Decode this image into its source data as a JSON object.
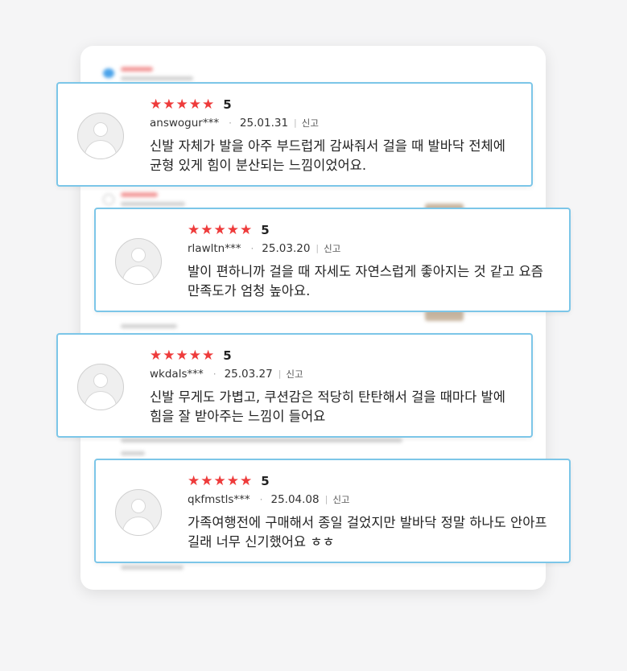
{
  "reviews": [
    {
      "rating_stars": "★★★★★",
      "score": "5",
      "username": "answogur***",
      "date": "25.01.31",
      "report_label": "신고",
      "text": "신발 자체가 발을 아주 부드럽게 감싸줘서 걸을 때 발바닥 전체에 균형 있게 힘이 분산되는 느낌이었어요."
    },
    {
      "rating_stars": "★★★★★",
      "score": "5",
      "username": "rlawltn***",
      "date": "25.03.20",
      "report_label": "신고",
      "text": "발이 편하니까 걸을 때 자세도 자연스럽게 좋아지는 것 같고 요즘 만족도가 엄청 높아요."
    },
    {
      "rating_stars": "★★★★★",
      "score": "5",
      "username": "wkdals***",
      "date": "25.03.27",
      "report_label": "신고",
      "text": "신발 무게도 가볍고, 쿠션감은 적당히 탄탄해서 걸을 때마다 발에 힘을 잘 받아주는 느낌이 들어요"
    },
    {
      "rating_stars": "★★★★★",
      "score": "5",
      "username": "qkfmstls***",
      "date": "25.04.08",
      "report_label": "신고",
      "text": "가족여행전에 구매해서 종일 걸었지만 발바닥 정말 하나도 안아프길래 너무 신기했어요 ㅎㅎ"
    }
  ],
  "colors": {
    "star": "#ee3b3b",
    "card_border": "#7cc6e8",
    "background": "#f5f5f6"
  }
}
